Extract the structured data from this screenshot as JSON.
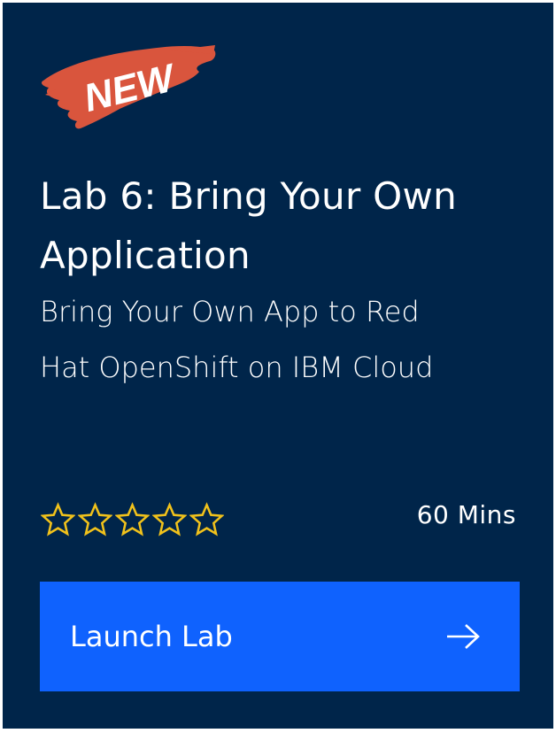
{
  "card": {
    "badge_text": "NEW",
    "title": "Lab 6: Bring Your Own Application",
    "subtitle": "Bring Your Own App to Red Hat OpenShift on IBM Cloud",
    "rating": {
      "filled": 0,
      "max": 5
    },
    "duration": "60 Mins",
    "launch_label": "Launch Lab",
    "launch_icon": "arrow-right-icon"
  },
  "colors": {
    "card_background": "#00254a",
    "badge_brush": "#d9553d",
    "star_outline": "#f1c21b",
    "button_background": "#0f62fe",
    "text": "#ffffff"
  }
}
